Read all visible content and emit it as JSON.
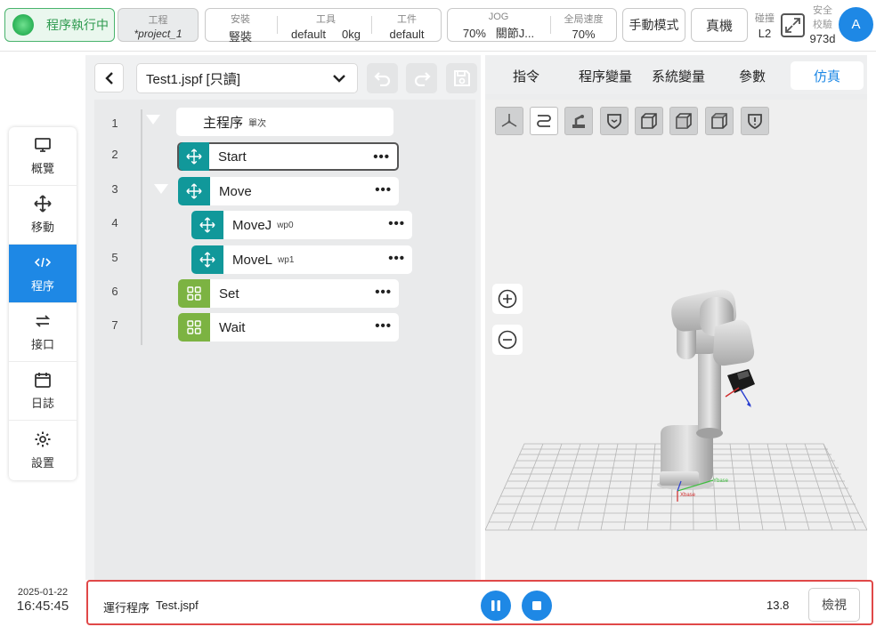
{
  "topbar": {
    "run_status": "程序執行中",
    "project": {
      "label": "工程",
      "value": "*project_1"
    },
    "config": [
      {
        "label": "安裝",
        "value": "豎裝"
      },
      {
        "label": "工具",
        "value": "default     0kg"
      },
      {
        "label": "工件",
        "value": "default"
      }
    ],
    "motion": [
      {
        "label": "JOG",
        "value": "70%   關節J..."
      },
      {
        "label": "全局速度",
        "value": "70%"
      }
    ],
    "mode_button": "手動模式",
    "machine_button": "真機",
    "collision": {
      "label": "碰撞",
      "value": "L2"
    },
    "safety": {
      "label1": "安全",
      "label2": "校驗",
      "value": "973d"
    },
    "avatar": "A"
  },
  "sidebar": {
    "items": [
      {
        "label": "概覽",
        "icon": "monitor-icon"
      },
      {
        "label": "移動",
        "icon": "move-icon"
      },
      {
        "label": "程序",
        "icon": "code-icon",
        "active": true
      },
      {
        "label": "接口",
        "icon": "swap-icon"
      },
      {
        "label": "日誌",
        "icon": "calendar-icon"
      },
      {
        "label": "設置",
        "icon": "gear-icon"
      }
    ]
  },
  "datetime": {
    "date": "2025-01-22",
    "time": "16:45:45"
  },
  "editor": {
    "file": "Test1.jspf [只讀]",
    "tree": [
      {
        "line": "1",
        "label": "主程序",
        "sub": "單次"
      },
      {
        "line": "2",
        "label": "Start",
        "sub": ""
      },
      {
        "line": "3",
        "label": "Move",
        "sub": ""
      },
      {
        "line": "4",
        "label": "MoveJ",
        "sub": "wp0"
      },
      {
        "line": "5",
        "label": "MoveL",
        "sub": "wp1"
      },
      {
        "line": "6",
        "label": "Set",
        "sub": ""
      },
      {
        "line": "7",
        "label": "Wait",
        "sub": ""
      }
    ]
  },
  "tabs": [
    {
      "label": "指令"
    },
    {
      "label": "程序變量"
    },
    {
      "label": "系統變量"
    },
    {
      "label": "參數"
    },
    {
      "label": "仿真",
      "active": true
    }
  ],
  "scene": {
    "axis_x": "Xbase",
    "axis_y": "Ybase"
  },
  "bottombar": {
    "label": "運行程序",
    "file": "Test.jspf",
    "speed": "13.8",
    "check_button": "檢視"
  }
}
